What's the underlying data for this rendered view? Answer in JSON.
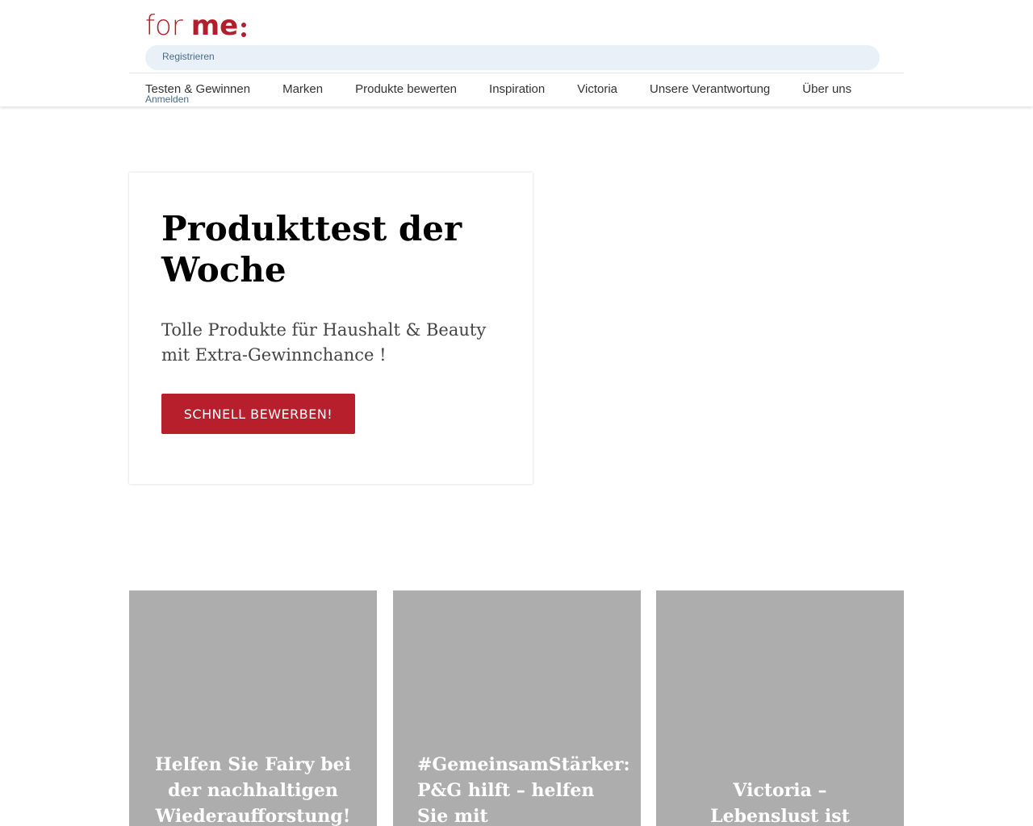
{
  "header": {
    "logo": {
      "left": "for",
      "right": "me"
    },
    "search": {
      "register_label": "Registrieren"
    },
    "nav": [
      "Testen & Gewinnen",
      "Marken",
      "Produkte bewerten",
      "Inspiration",
      "Victoria",
      "Unsere Verantwortung",
      "Über uns"
    ],
    "login_label": "Anmelden"
  },
  "hero": {
    "title": "Produkttest der Woche",
    "subtitle": "Tolle Produkte für Haushalt & Beauty mit Extra-Gewinnchance !",
    "button_label": "SCHNELL BEWERBEN!"
  },
  "tiles": [
    {
      "title": "Helfen Sie Fairy bei der nachhaltigen Wiederaufforstung!"
    },
    {
      "title": "#GemeinsamStärker: P&G hilft – helfen Sie mit"
    },
    {
      "title": "Victoria – Lebenslust ist zeitlos"
    }
  ],
  "colors": {
    "brand": "#b11e2d",
    "button": "#b61f2b",
    "search_bg": "#e9f0f8",
    "tile_bg": "#adadad"
  }
}
